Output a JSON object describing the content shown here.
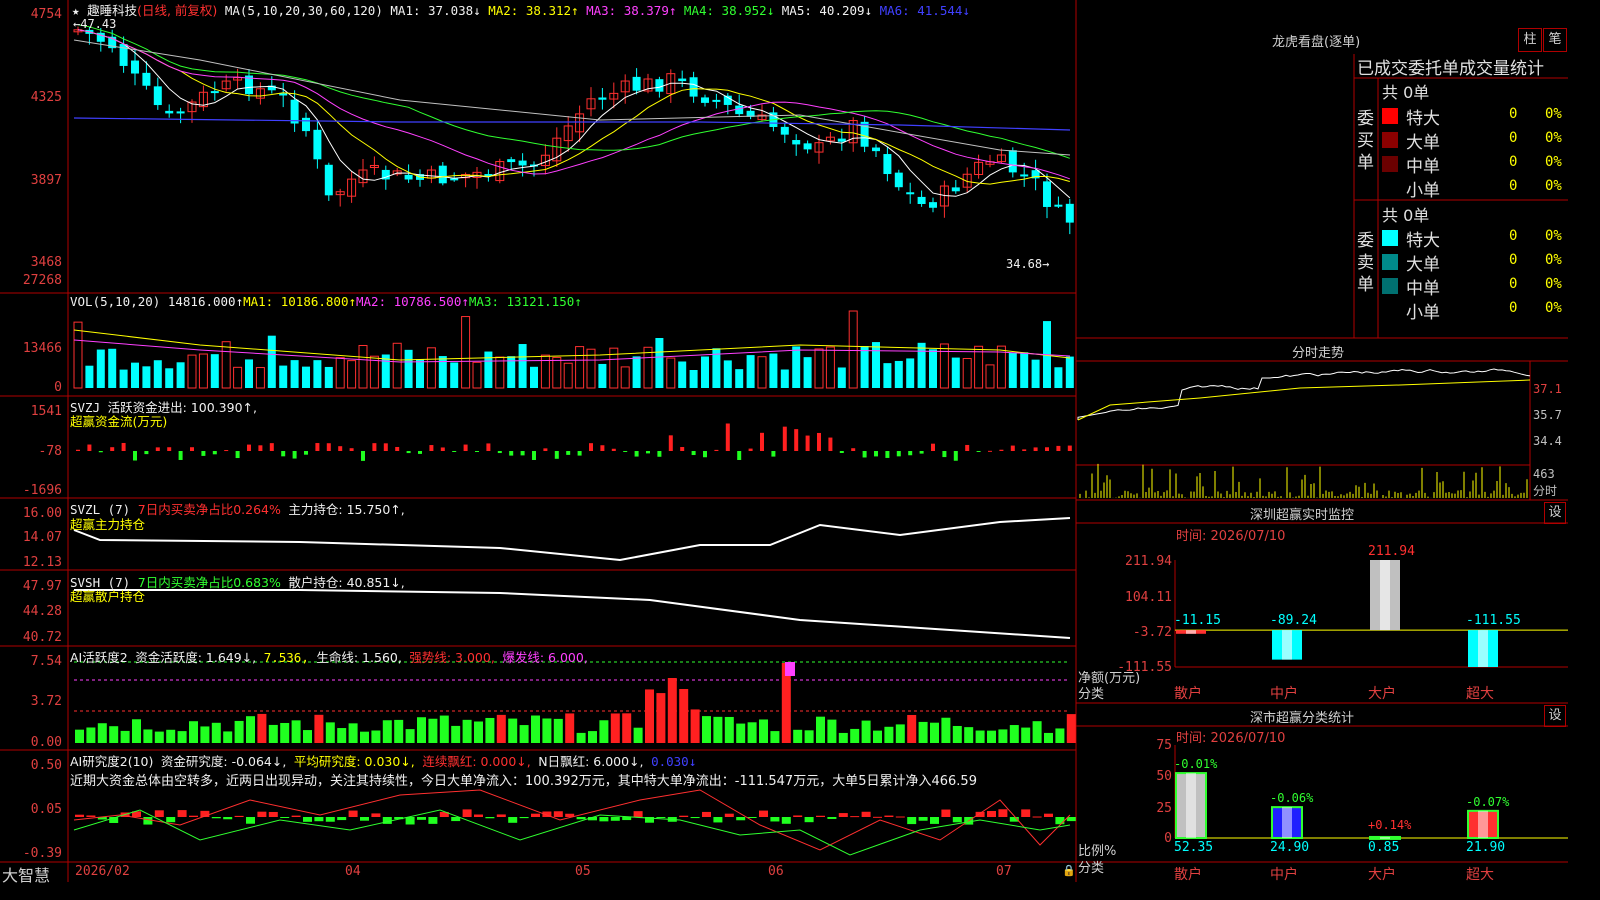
{
  "stock": {
    "star": "★",
    "name": "趣睡科技",
    "period": "(日线, 前复权)",
    "ma_header": "MA(5,10,20,30,60,120)",
    "ma1": "MA1: 37.038↓",
    "ma2": "MA2: 38.312↑",
    "ma3": "MA3: 38.379↑",
    "ma4": "MA4: 38.952↓",
    "ma5": "MA5: 40.209↓",
    "ma6": "MA6: 41.544↓",
    "high_mark": "47.43",
    "low_mark": "34.68"
  },
  "price_axis": [
    "4754",
    "4325",
    "3897",
    "3468"
  ],
  "vol": {
    "label": "VOL(5,10,20)",
    "value": "14816.000↑",
    "ma1": "MA1: 10186.800↑",
    "ma2": "MA2: 10786.500↑",
    "ma3": "MA3: 13121.150↑",
    "axis": [
      "27268",
      "13466",
      "0"
    ]
  },
  "svzj": {
    "label": "SVZJ",
    "text": "活跃资金进出: 100.390↑,",
    "subtitle": "超赢资金流(万元)",
    "axis": [
      "1541",
      "-78",
      "-1696"
    ]
  },
  "svzl": {
    "label": "SVZL (7)",
    "text1": "7日内买卖净占比0.264%",
    "text2": "主力持仓: 15.750↑,",
    "subtitle": "超赢主力持仓",
    "axis": [
      "16.00",
      "14.07",
      "12.13"
    ]
  },
  "svsh": {
    "label": "SVSH (7)",
    "text1": "7日内买卖净占比0.683%",
    "text2": "散户持仓: 40.851↓,",
    "subtitle": "超赢散户持仓",
    "axis": [
      "47.97",
      "44.28",
      "40.72"
    ]
  },
  "ai_active": {
    "label": "AI活跃度2",
    "t1": "资金活跃度: 1.649↓,",
    "t2": "7.536,",
    "t3": "生命线: 1.560,",
    "t4": "强势线: 3.000,",
    "t5": "爆发线: 6.000,",
    "axis": [
      "7.54",
      "3.72",
      "0.00"
    ]
  },
  "ai_research": {
    "label": "AI研究度2(10)",
    "t1": "资金研究度: -0.064↓,",
    "t2": "平均研究度: 0.030↓,",
    "t3": "连续飘红: 0.000↓,",
    "t4": "N日飘红: 6.000↓,",
    "t5": "0.030↓",
    "comment": "近期大资金总体由空转多，近两日出现异动，关注其持续性，今日大单净流入：100.392万元，其中特大单净流出：-111.547万元，大单5日累计净入466.59",
    "axis": [
      "0.50",
      "0.05",
      "-0.39"
    ]
  },
  "date_axis": [
    "2026/02",
    "04",
    "05",
    "06",
    "07"
  ],
  "brand": "大智慧",
  "right": {
    "title": "龙虎看盘(逐单)",
    "btn1": "柱",
    "btn2": "笔",
    "sub_title": "已成交委托单成交量统计",
    "buy_side": "委买单",
    "sell_side": "委卖单",
    "buy_total": "共 0单",
    "sell_total": "共 0单",
    "buy_rows": [
      {
        "label": "特大",
        "val": "0",
        "pct": "0%",
        "color": "#ff0000"
      },
      {
        "label": "大单",
        "val": "0",
        "pct": "0%",
        "color": "#8b0000"
      },
      {
        "label": "中单",
        "val": "0",
        "pct": "0%",
        "color": "#6b0000"
      },
      {
        "label": "小单",
        "val": "0",
        "pct": "0%",
        "color": "#000000"
      }
    ],
    "sell_rows": [
      {
        "label": "特大",
        "val": "0",
        "pct": "0%",
        "color": "#00ffff"
      },
      {
        "label": "大单",
        "val": "0",
        "pct": "0%",
        "color": "#008b8b"
      },
      {
        "label": "中单",
        "val": "0",
        "pct": "0%",
        "color": "#007070"
      },
      {
        "label": "小单",
        "val": "0",
        "pct": "0%",
        "color": "#000000"
      }
    ],
    "intraday_title": "分时走势",
    "intraday_axis": [
      "37.1",
      "35.7",
      "34.4",
      "463",
      "分时"
    ],
    "sz_title": "深圳超赢实时监控",
    "sz_btn": "设",
    "sz_time": "时间: 2026/07/10",
    "sz_axis": [
      "211.94",
      "104.11",
      "-3.72",
      "-111.55"
    ],
    "sz_ylabel": "净额(万元)",
    "sz_xlabel": "分类",
    "sz_cats": [
      "散户",
      "中户",
      "大户",
      "超大"
    ],
    "sz_values": [
      "-11.15",
      "-89.24",
      "211.94",
      "-111.55"
    ],
    "dist_title": "深市超赢分类统计",
    "dist_btn": "设",
    "dist_time": "时间: 2026/07/10",
    "dist_axis": [
      "75",
      "50",
      "25",
      "0"
    ],
    "dist_ylabel": "比例%",
    "dist_xlabel": "分类",
    "dist_cats": [
      "散户",
      "中户",
      "大户",
      "超大"
    ],
    "dist_top": [
      "-0.01%",
      "-0.06%",
      "+0.14%",
      "-0.07%"
    ],
    "dist_bottom": [
      "52.35",
      "24.90",
      "0.85",
      "21.90"
    ]
  },
  "chart_data": {
    "type": "bar",
    "title": "深圳超赢实时监控",
    "categories": [
      "散户",
      "中户",
      "大户",
      "超大"
    ],
    "series": [
      {
        "name": "净额(万元)",
        "values": [
          -11.15,
          -89.24,
          211.94,
          -111.55
        ]
      },
      {
        "name": "比例%",
        "values": [
          52.35,
          24.9,
          0.85,
          21.9
        ]
      }
    ],
    "ylim": [
      -111.55,
      211.94
    ]
  }
}
